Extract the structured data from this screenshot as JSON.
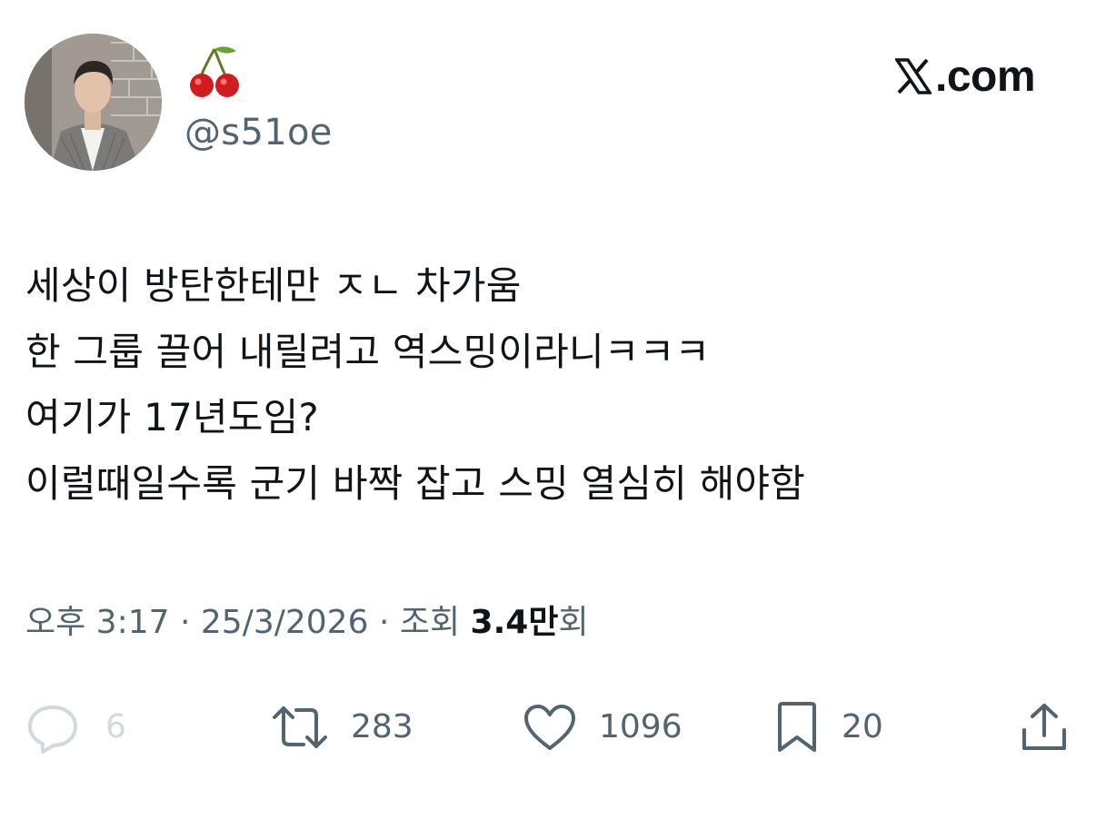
{
  "author": {
    "display_name_icon": "cherries-emoji",
    "handle": "@s51oe",
    "avatar": "profile-photo"
  },
  "brand": {
    "label": ".com",
    "logo_icon": "x-logo-icon"
  },
  "tweet": {
    "lines": [
      "세상이 방탄한테만 ㅈㄴ 차가움",
      "한 그룹 끌어 내릴려고 역스밍이라니ㅋㅋㅋ",
      "여기가 17년도임?",
      "이럴때일수록 군기 바짝 잡고 스밍 열심히 해야함"
    ]
  },
  "meta": {
    "time": "오후 3:17",
    "separator": "·",
    "date": "25/3/2026",
    "views_label": "조회",
    "views_count": "3.4만",
    "views_suffix": "회"
  },
  "actions": {
    "reply": {
      "icon": "reply-icon",
      "count": "6"
    },
    "retweet": {
      "icon": "retweet-icon",
      "count": "283"
    },
    "like": {
      "icon": "heart-icon",
      "count": "1096"
    },
    "bookmark": {
      "icon": "bookmark-icon",
      "count": "20"
    },
    "share": {
      "icon": "share-icon"
    }
  },
  "colors": {
    "text": "#0f1419",
    "secondary": "#536471",
    "muted": "#cfd9de"
  }
}
